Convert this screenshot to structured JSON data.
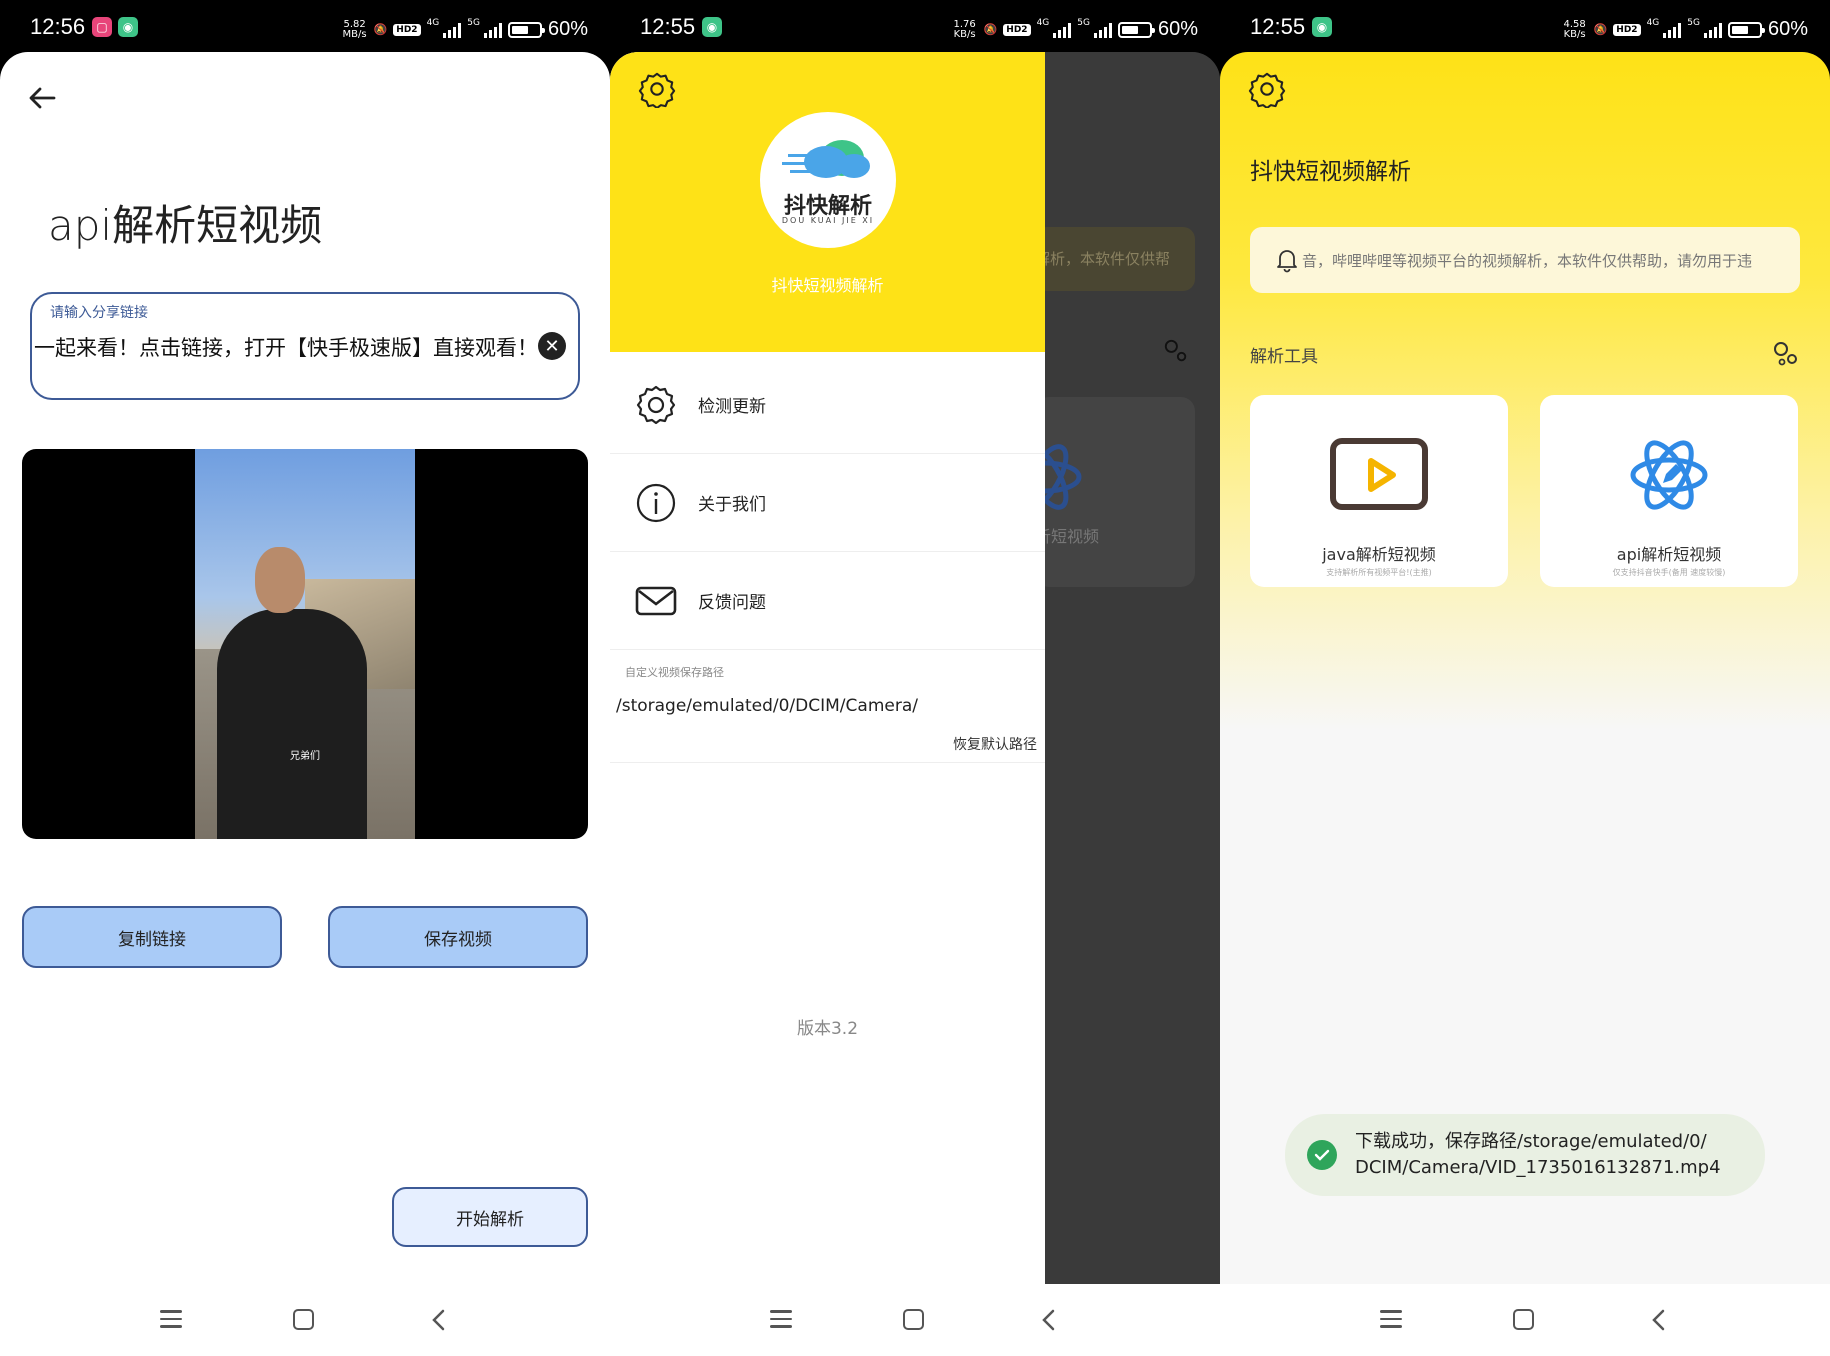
{
  "panel1": {
    "status": {
      "time": "12:56",
      "speed": "5.82\nMB/s",
      "battery": "60%",
      "battery_level": 0.6
    },
    "title": "api解析短视频",
    "share_field": {
      "label": "请输入分享链接",
      "value": "一起来看！点击链接，打开【快手极速版】直接观看！"
    },
    "video_caption": "兄弟们",
    "buttons": {
      "copy": "复制链接",
      "save": "保存视频",
      "start": "开始解析"
    }
  },
  "panel2": {
    "status": {
      "time": "12:55",
      "speed": "1.76\nKB/s",
      "battery": "60%",
      "battery_level": 0.6
    },
    "logo": {
      "text": "抖快解析",
      "sub": "DOU KUAI JIE XI"
    },
    "app_name": "抖快短视频解析",
    "menu": [
      {
        "label": "检测更新",
        "icon": "gear-icon"
      },
      {
        "label": "关于我们",
        "icon": "info-icon"
      },
      {
        "label": "反馈问题",
        "icon": "mail-icon"
      }
    ],
    "path": {
      "label": "自定义视频保存路径",
      "value": "/storage/emulated/0/DCIM/Camera/",
      "reset": "恢复默认路径"
    },
    "version": "版本3.2",
    "behind": {
      "notice": "解析，本软件仅供帮",
      "card_label": "析短视频"
    }
  },
  "panel3": {
    "status": {
      "time": "12:55",
      "speed": "4.58\nKB/s",
      "battery": "60%",
      "battery_level": 0.6
    },
    "title": "抖快短视频解析",
    "notice": "音，哔哩哔哩等视频平台的视频解析，本软件仅供帮助，请勿用于违",
    "section": "解析工具",
    "tools": [
      {
        "label": "java解析短视频",
        "sub": "支持解析所有视频平台!(主推)"
      },
      {
        "label": "api解析短视频",
        "sub": "仅支持抖音快手(备用 速度较慢)"
      }
    ],
    "toast": "下载成功，保存路径/storage/emulated/0/\nDCIM/Camera/VID_1735016132871.mp4"
  },
  "colors": {
    "accent_yellow": "#fee217",
    "button_blue": "#a9cbf7",
    "border_blue": "#3d5a96",
    "success_green": "#2fa55b"
  }
}
